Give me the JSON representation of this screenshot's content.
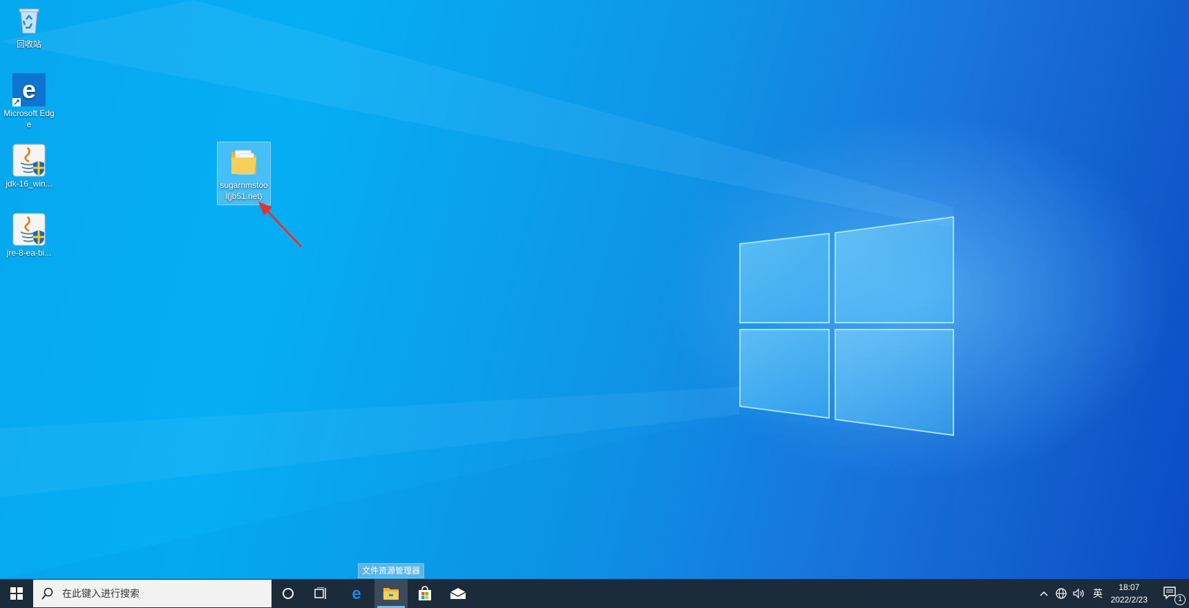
{
  "desktop": {
    "icons": [
      {
        "label": "回收站",
        "icon": "recycle-bin-icon"
      },
      {
        "label": "Microsoft Edge",
        "icon": "edge-icon"
      },
      {
        "label": "jdk-16_win...",
        "icon": "java-installer-icon"
      },
      {
        "label": "jre-8-ea-bi...",
        "icon": "java-installer-icon"
      },
      {
        "label": "sugarnmstool(jb51.net)",
        "icon": "folder-icon",
        "selected": true
      }
    ]
  },
  "taskbar": {
    "search_placeholder": "在此键入进行搜索",
    "tooltip": "文件资源管理器",
    "ime_label": "英",
    "clock_time": "18:07",
    "clock_date": "2022/2/23",
    "notification_count": "1"
  },
  "colors": {
    "taskbar": "#1c2b3a",
    "annotation_arrow": "#e5322d",
    "desktop_primary": "#05aef3"
  }
}
